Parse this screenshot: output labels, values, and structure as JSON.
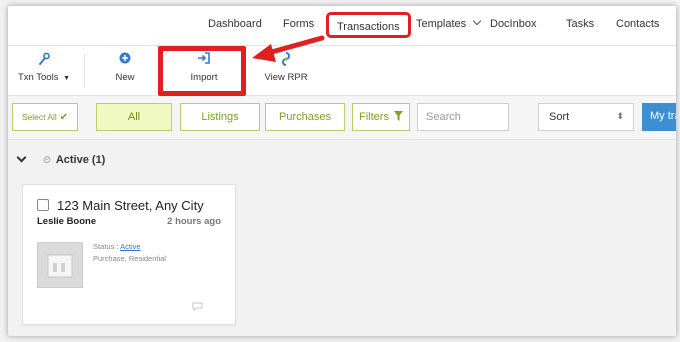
{
  "topnav": {
    "items": [
      "Dashboard",
      "Forms",
      "Transactions",
      "Templates",
      "DocInbox",
      "Tasks",
      "Contacts"
    ]
  },
  "toolbar": {
    "txn_tools": "Txn Tools",
    "new": "New",
    "import": "Import",
    "view_rpr": "View RPR"
  },
  "filters": {
    "select_all": "Select All",
    "all": "All",
    "listings": "Listings",
    "purchases": "Purchases",
    "filters": "Filters",
    "search_placeholder": "Search",
    "sort": "Sort",
    "my_transactions": "My tra"
  },
  "section": {
    "label": "Active",
    "count": "(1)"
  },
  "card": {
    "title": "123 Main Street, Any City",
    "agent": "Leslie Boone",
    "time": "2 hours ago",
    "status_label": "Status : ",
    "status_value": "Active",
    "property": "Purchase, Residential"
  },
  "colors": {
    "highlight_red": "#e0201f",
    "accent_green": "#7ea120",
    "primary_blue": "#3d8fd4"
  }
}
